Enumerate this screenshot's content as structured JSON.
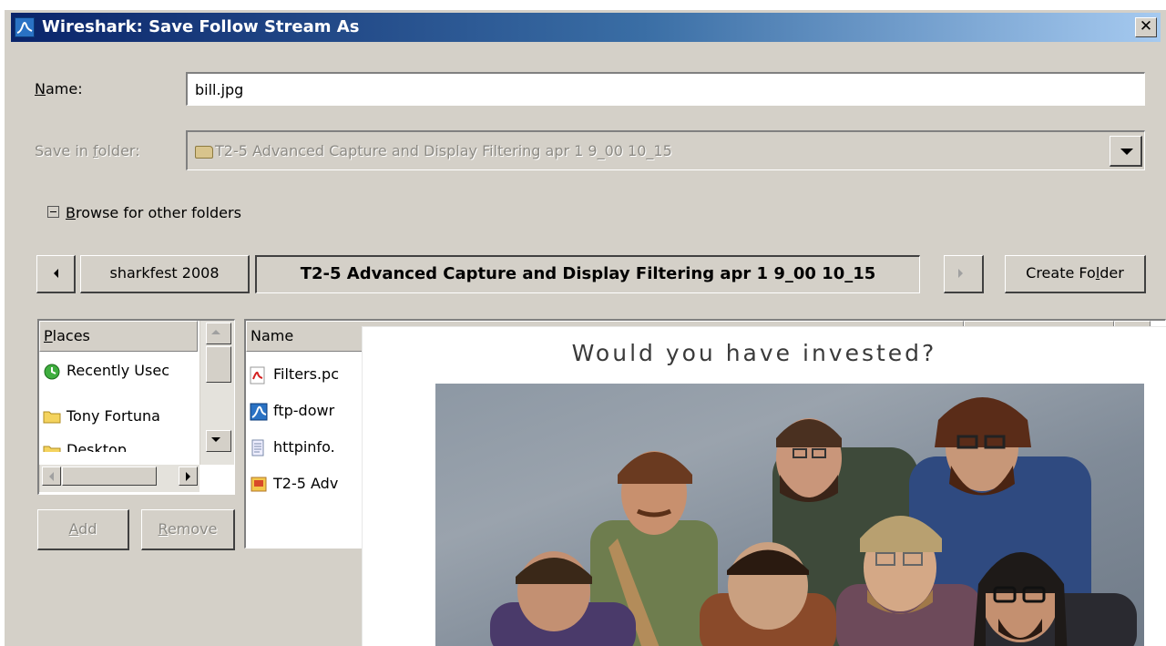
{
  "window": {
    "title": "Wireshark: Save Follow Stream As",
    "close_glyph": "✕"
  },
  "form": {
    "name_label_mnemonic": "N",
    "name_label_rest": "ame:",
    "name_value": "bill.jpg",
    "folder_label_pre": "Save in ",
    "folder_label_mnemonic": "f",
    "folder_label_post": "older:",
    "folder_value": "T2-5 Advanced Capture and Display Filtering apr 1 9_00 10_15",
    "browse_mnemonic": "B",
    "browse_rest": "rowse for other folders"
  },
  "pathbar": {
    "back_icon": "chevron-left-icon",
    "crumbs": [
      "sharkfest 2008",
      "T2-5 Advanced Capture and Display Filtering apr 1 9_00 10_15"
    ],
    "forward_icon": "chevron-right-icon",
    "create_folder_pre": "Create Fo",
    "create_folder_mnemonic": "l",
    "create_folder_post": "der"
  },
  "places": {
    "header_mnemonic": "P",
    "header_rest": "laces",
    "items": [
      {
        "label": "Recently Usec",
        "icon": "recent-icon"
      },
      {
        "label": "Tony Fortuna",
        "icon": "folder-icon"
      },
      {
        "label": "Desktop",
        "icon": "folder-icon"
      }
    ],
    "add_mnemonic": "A",
    "add_rest": "dd",
    "remove_mnemonic": "R",
    "remove_rest": "emove"
  },
  "files": {
    "header_name": "Name",
    "rows": [
      {
        "label": "Filters.pc",
        "icon": "pdf-icon"
      },
      {
        "label": "ftp-dowr",
        "icon": "wireshark-capture-icon"
      },
      {
        "label": "httpinfo.",
        "icon": "text-file-icon"
      },
      {
        "label": "T2-5 Adv",
        "icon": "presentation-icon"
      }
    ]
  },
  "overlay": {
    "caption": "Would you have invested?"
  },
  "colors": {
    "dialog_bg": "#d4d0c8",
    "title_gradient_start": "#0a246a",
    "title_gradient_end": "#a6caf0"
  }
}
